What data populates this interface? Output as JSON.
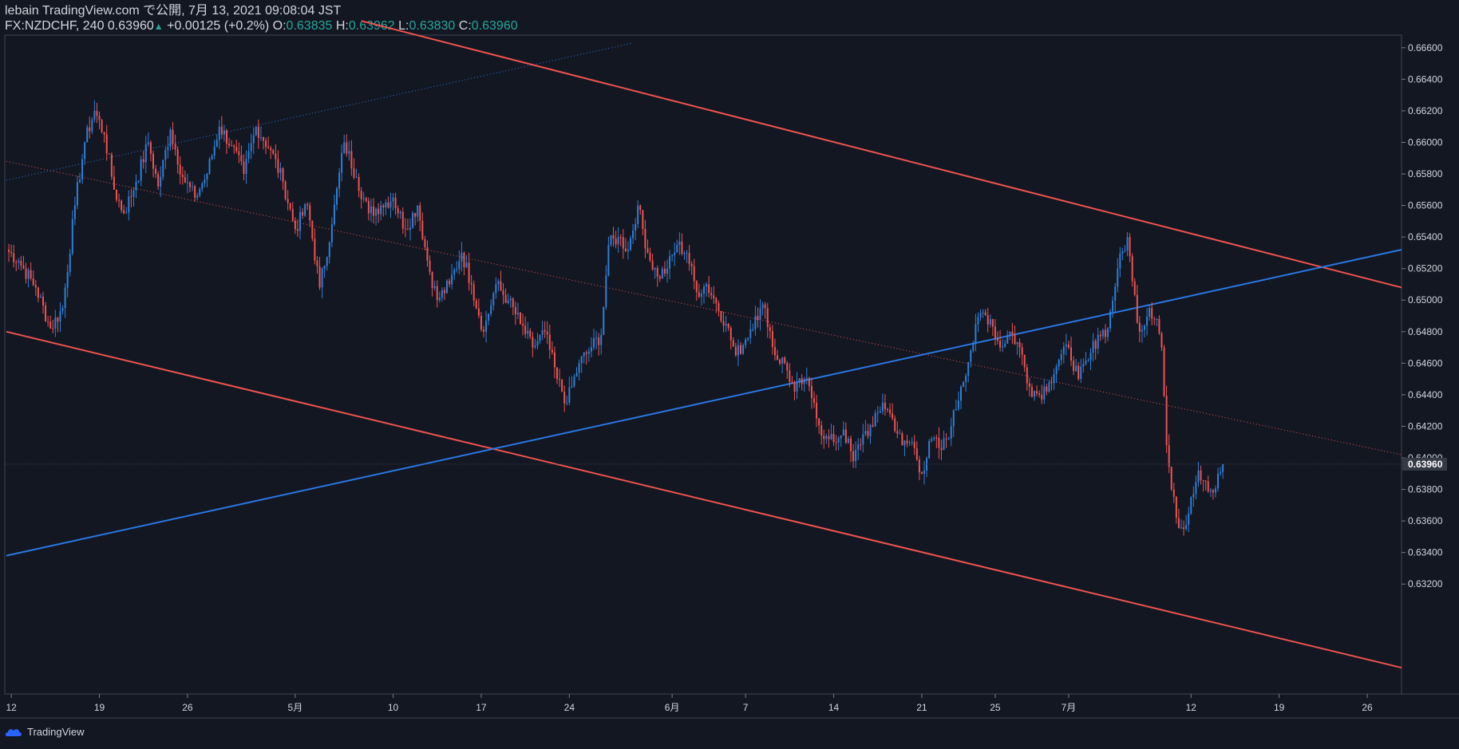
{
  "header": {
    "publisher": "lebain TradingView.com で公開, 7月 13, 2021 09:08:04 JST",
    "symbol": "FX:NZDCHF, 240",
    "last": "0.63960",
    "change": "+0.00125 (+0.2%)",
    "o_label": "O:",
    "o": "0.63835",
    "h_label": "H:",
    "h": "0.63962",
    "l_label": "L:",
    "l": "0.63830",
    "c_label": "C:",
    "c": "0.63960"
  },
  "footer": {
    "brand": "TradingView"
  },
  "colors": {
    "background": "#131722",
    "up": "#2f7fd6",
    "down": "#ef5350",
    "channel_line": "#ef5350",
    "trend_line": "#2a78e4",
    "text": "#d1d4dc",
    "accent_green": "#26a69a"
  },
  "chart_data": {
    "type": "candlestick",
    "symbol": "FX:NZDCHF",
    "interval": "240",
    "ylim": [
      0.631,
      0.6668
    ],
    "y_ticks": [
      "0.66600",
      "0.66400",
      "0.66200",
      "0.66000",
      "0.65800",
      "0.65600",
      "0.65400",
      "0.65200",
      "0.65000",
      "0.64800",
      "0.64600",
      "0.64400",
      "0.64200",
      "0.64000",
      "0.63800",
      "0.63600",
      "0.63400",
      "0.63200"
    ],
    "last_price_label": "0.63960",
    "last_price": 0.6396,
    "x_ticks": [
      "12",
      "19",
      "26",
      "5月",
      "10",
      "17",
      "24",
      "6月",
      "7",
      "14",
      "21",
      "25",
      "7月",
      "12",
      "19",
      "26"
    ],
    "x_tick_index": [
      2,
      38,
      74,
      118,
      158,
      194,
      230,
      272,
      302,
      338,
      374,
      404,
      434,
      484,
      520,
      556
    ],
    "x_range": [
      0,
      570
    ],
    "anchors": [
      [
        0,
        0.6532
      ],
      [
        5,
        0.6525
      ],
      [
        12,
        0.6508
      ],
      [
        18,
        0.6482
      ],
      [
        23,
        0.6495
      ],
      [
        28,
        0.656
      ],
      [
        32,
        0.66
      ],
      [
        36,
        0.662
      ],
      [
        40,
        0.6605
      ],
      [
        44,
        0.657
      ],
      [
        48,
        0.6555
      ],
      [
        53,
        0.6575
      ],
      [
        58,
        0.66
      ],
      [
        62,
        0.6572
      ],
      [
        67,
        0.6608
      ],
      [
        72,
        0.6578
      ],
      [
        77,
        0.6565
      ],
      [
        82,
        0.658
      ],
      [
        87,
        0.661
      ],
      [
        92,
        0.6598
      ],
      [
        97,
        0.658
      ],
      [
        102,
        0.661
      ],
      [
        108,
        0.6595
      ],
      [
        113,
        0.6575
      ],
      [
        118,
        0.6545
      ],
      [
        123,
        0.656
      ],
      [
        128,
        0.6508
      ],
      [
        133,
        0.6548
      ],
      [
        138,
        0.66
      ],
      [
        143,
        0.6578
      ],
      [
        148,
        0.6555
      ],
      [
        153,
        0.656
      ],
      [
        158,
        0.6565
      ],
      [
        163,
        0.6545
      ],
      [
        168,
        0.656
      ],
      [
        172,
        0.6525
      ],
      [
        176,
        0.65
      ],
      [
        181,
        0.651
      ],
      [
        186,
        0.653
      ],
      [
        190,
        0.651
      ],
      [
        195,
        0.648
      ],
      [
        200,
        0.651
      ],
      [
        205,
        0.65
      ],
      [
        210,
        0.6485
      ],
      [
        215,
        0.647
      ],
      [
        220,
        0.648
      ],
      [
        225,
        0.645
      ],
      [
        229,
        0.6435
      ],
      [
        234,
        0.646
      ],
      [
        239,
        0.647
      ],
      [
        243,
        0.6478
      ],
      [
        246,
        0.6535
      ],
      [
        250,
        0.654
      ],
      [
        254,
        0.6532
      ],
      [
        258,
        0.656
      ],
      [
        262,
        0.653
      ],
      [
        266,
        0.6515
      ],
      [
        270,
        0.652
      ],
      [
        274,
        0.6535
      ],
      [
        278,
        0.653
      ],
      [
        282,
        0.6505
      ],
      [
        286,
        0.651
      ],
      [
        290,
        0.6498
      ],
      [
        294,
        0.6485
      ],
      [
        298,
        0.6465
      ],
      [
        302,
        0.6475
      ],
      [
        306,
        0.649
      ],
      [
        310,
        0.6495
      ],
      [
        314,
        0.6465
      ],
      [
        318,
        0.646
      ],
      [
        322,
        0.6442
      ],
      [
        326,
        0.645
      ],
      [
        330,
        0.6435
      ],
      [
        334,
        0.6412
      ],
      [
        338,
        0.641
      ],
      [
        342,
        0.6418
      ],
      [
        346,
        0.6398
      ],
      [
        350,
        0.6415
      ],
      [
        354,
        0.642
      ],
      [
        358,
        0.6435
      ],
      [
        362,
        0.6425
      ],
      [
        366,
        0.6408
      ],
      [
        370,
        0.641
      ],
      [
        374,
        0.639
      ],
      [
        378,
        0.6412
      ],
      [
        382,
        0.6405
      ],
      [
        386,
        0.642
      ],
      [
        390,
        0.6445
      ],
      [
        394,
        0.6468
      ],
      [
        398,
        0.6492
      ],
      [
        402,
        0.6488
      ],
      [
        406,
        0.647
      ],
      [
        410,
        0.648
      ],
      [
        414,
        0.647
      ],
      [
        418,
        0.6445
      ],
      [
        422,
        0.644
      ],
      [
        426,
        0.6448
      ],
      [
        430,
        0.6462
      ],
      [
        434,
        0.647
      ],
      [
        438,
        0.645
      ],
      [
        442,
        0.6462
      ],
      [
        446,
        0.6478
      ],
      [
        450,
        0.6482
      ],
      [
        454,
        0.652
      ],
      [
        458,
        0.654
      ],
      [
        460,
        0.6512
      ],
      [
        463,
        0.648
      ],
      [
        467,
        0.6495
      ],
      [
        470,
        0.6488
      ],
      [
        472,
        0.647
      ],
      [
        474,
        0.6408
      ],
      [
        476,
        0.638
      ],
      [
        478,
        0.6362
      ],
      [
        481,
        0.6355
      ],
      [
        484,
        0.6375
      ],
      [
        487,
        0.6392
      ],
      [
        490,
        0.6385
      ],
      [
        493,
        0.6378
      ],
      [
        497,
        0.6396
      ]
    ],
    "channel_upper": {
      "x": [
        145,
        570
      ],
      "y": [
        0.6677,
        0.6508
      ]
    },
    "channel_lower": {
      "x": [
        0,
        570
      ],
      "y": [
        0.648,
        0.6267
      ]
    },
    "channel_mid": {
      "x": [
        0,
        570
      ],
      "y": [
        0.6588,
        0.6402
      ]
    },
    "trend_line": {
      "x": [
        0,
        570
      ],
      "y": [
        0.6338,
        0.6532
      ]
    },
    "trend_dotted": {
      "x": [
        0,
        256
      ],
      "y": [
        0.6576,
        0.6663
      ]
    }
  }
}
